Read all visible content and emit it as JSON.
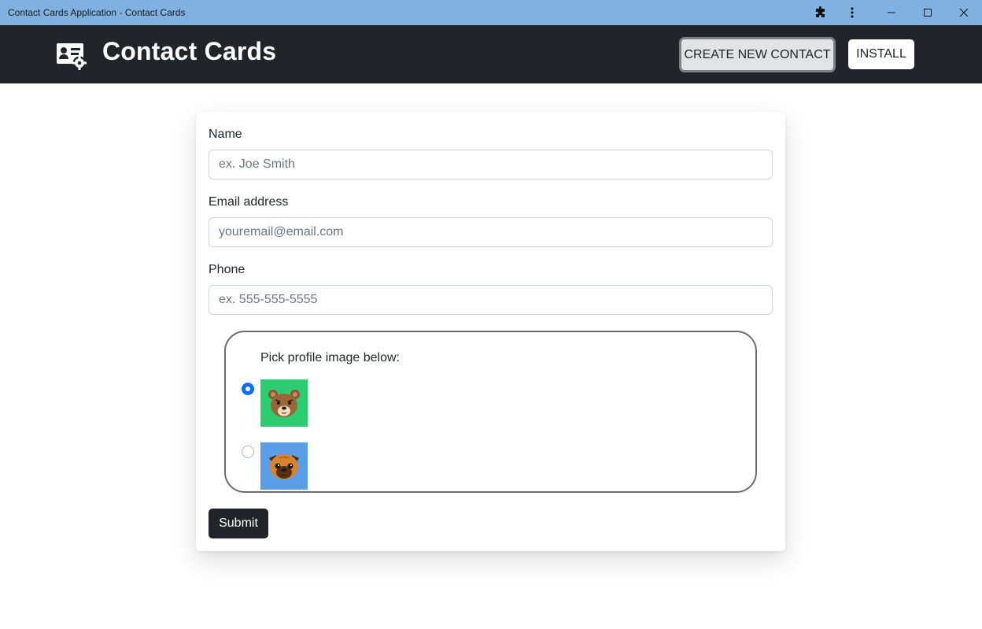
{
  "window": {
    "title": "Contact Cards Application - Contact Cards",
    "controls": [
      "extensions-icon",
      "menu-icon",
      "minimize-icon",
      "maximize-icon",
      "close-icon"
    ]
  },
  "navbar": {
    "brand_title": "Contact Cards",
    "brand_icon": "contact-card-icon",
    "create_label": "CREATE NEW CONTACT",
    "install_label": "INSTALL"
  },
  "form": {
    "name_label": "Name",
    "name_placeholder": "ex. Joe Smith",
    "name_value": "",
    "email_label": "Email address",
    "email_placeholder": "youremail@email.com",
    "email_value": "",
    "phone_label": "Phone",
    "phone_placeholder": "ex. 555-555-5555",
    "phone_value": "",
    "profile_label": "Pick profile image below:",
    "profile_options": [
      {
        "icon": "bear-avatar-icon",
        "selected": true,
        "bg": "#2ecc71"
      },
      {
        "icon": "pug-avatar-icon",
        "selected": false,
        "bg": "#5b9ee8"
      }
    ],
    "submit_label": "Submit"
  },
  "colors": {
    "titlebar": "#7fb2e0",
    "navbar": "#212529",
    "accent": "#0d6efd"
  }
}
